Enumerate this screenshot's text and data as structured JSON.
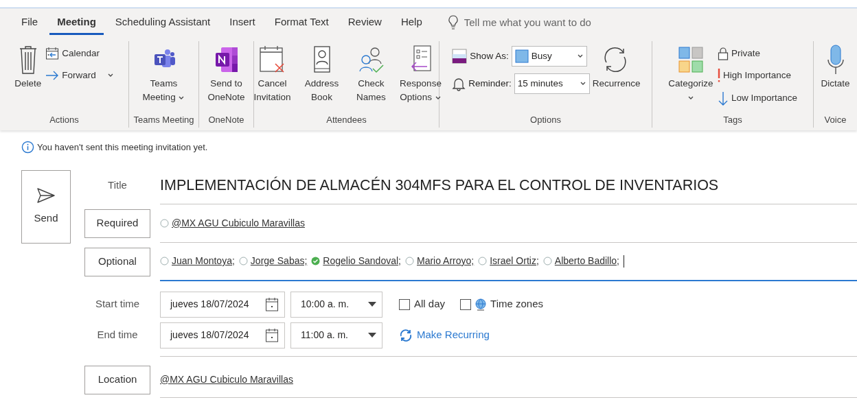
{
  "tabs": [
    {
      "label": "File",
      "selected": false
    },
    {
      "label": "Meeting",
      "selected": true
    },
    {
      "label": "Scheduling Assistant",
      "selected": false
    },
    {
      "label": "Insert",
      "selected": false
    },
    {
      "label": "Format Text",
      "selected": false
    },
    {
      "label": "Review",
      "selected": false
    },
    {
      "label": "Help",
      "selected": false
    }
  ],
  "tell_me": {
    "placeholder": "Tell me what you want to do"
  },
  "ribbon": [
    {
      "label": "Actions",
      "items": [
        {
          "kind": "large",
          "label": "Delete",
          "dropdown": false
        },
        {
          "kind": "small",
          "label": "Calendar",
          "dropdown": false
        },
        {
          "kind": "small",
          "label": "Forward",
          "dropdown": true
        }
      ]
    },
    {
      "label": "Teams Meeting",
      "items": [
        {
          "kind": "large",
          "label": "Teams Meeting",
          "dropdown": true
        }
      ]
    },
    {
      "label": "OneNote",
      "items": [
        {
          "kind": "large",
          "label": "Send to OneNote",
          "dropdown": false
        }
      ]
    },
    {
      "label": "Attendees",
      "items": [
        {
          "kind": "large",
          "label": "Cancel Invitation",
          "dropdown": false
        },
        {
          "kind": "large",
          "label": "Address Book",
          "dropdown": false
        },
        {
          "kind": "large",
          "label": "Check Names",
          "dropdown": false
        },
        {
          "kind": "large",
          "label": "Response Options",
          "dropdown": true
        }
      ]
    },
    {
      "label": "Options",
      "items": [
        {
          "kind": "select",
          "label": "Show As:",
          "value": "Busy"
        },
        {
          "kind": "select",
          "label": "Reminder:",
          "value": "15 minutes"
        },
        {
          "kind": "large",
          "label": "Recurrence",
          "dropdown": false
        }
      ]
    },
    {
      "label": "Tags",
      "items": [
        {
          "kind": "large",
          "label": "Categorize",
          "dropdown": true
        },
        {
          "kind": "small",
          "label": "Private",
          "dropdown": false
        },
        {
          "kind": "small",
          "label": "High Importance",
          "dropdown": false
        },
        {
          "kind": "small",
          "label": "Low Importance",
          "dropdown": false
        }
      ]
    },
    {
      "label": "Voice",
      "items": [
        {
          "kind": "large",
          "label": "Dictate",
          "dropdown": false
        }
      ]
    }
  ],
  "info": "You haven't sent this meeting invitation yet.",
  "send": "Send",
  "title": {
    "label": "Title",
    "value": "IMPLEMENTACIÓN DE ALMACÉN 304MFS PARA EL CONTROL DE INVENTARIOS"
  },
  "required": {
    "label": "Required",
    "attendees": [
      {
        "name": "@MX AGU Cubiculo Maravillas",
        "accepted": false
      }
    ]
  },
  "optional": {
    "label": "Optional",
    "attendees": [
      {
        "name": "Juan Montoya;",
        "accepted": false
      },
      {
        "name": "Jorge Sabas;",
        "accepted": false
      },
      {
        "name": "Rogelio Sandoval;",
        "accepted": true
      },
      {
        "name": "Mario Arroyo;",
        "accepted": false
      },
      {
        "name": "Israel Ortiz;",
        "accepted": false
      },
      {
        "name": "Alberto Badillo;",
        "accepted": false
      }
    ]
  },
  "start": {
    "label": "Start time",
    "date": "jueves 18/07/2024",
    "time": "10:00 a. m."
  },
  "end": {
    "label": "End time",
    "date": "jueves 18/07/2024",
    "time": "11:00 a. m."
  },
  "all_day": {
    "label": "All day",
    "checked": false
  },
  "time_zones": {
    "label": "Time zones",
    "checked": false
  },
  "make_recurring": "Make Recurring",
  "location": {
    "label": "Location",
    "value": "@MX AGU Cubiculo Maravillas"
  }
}
